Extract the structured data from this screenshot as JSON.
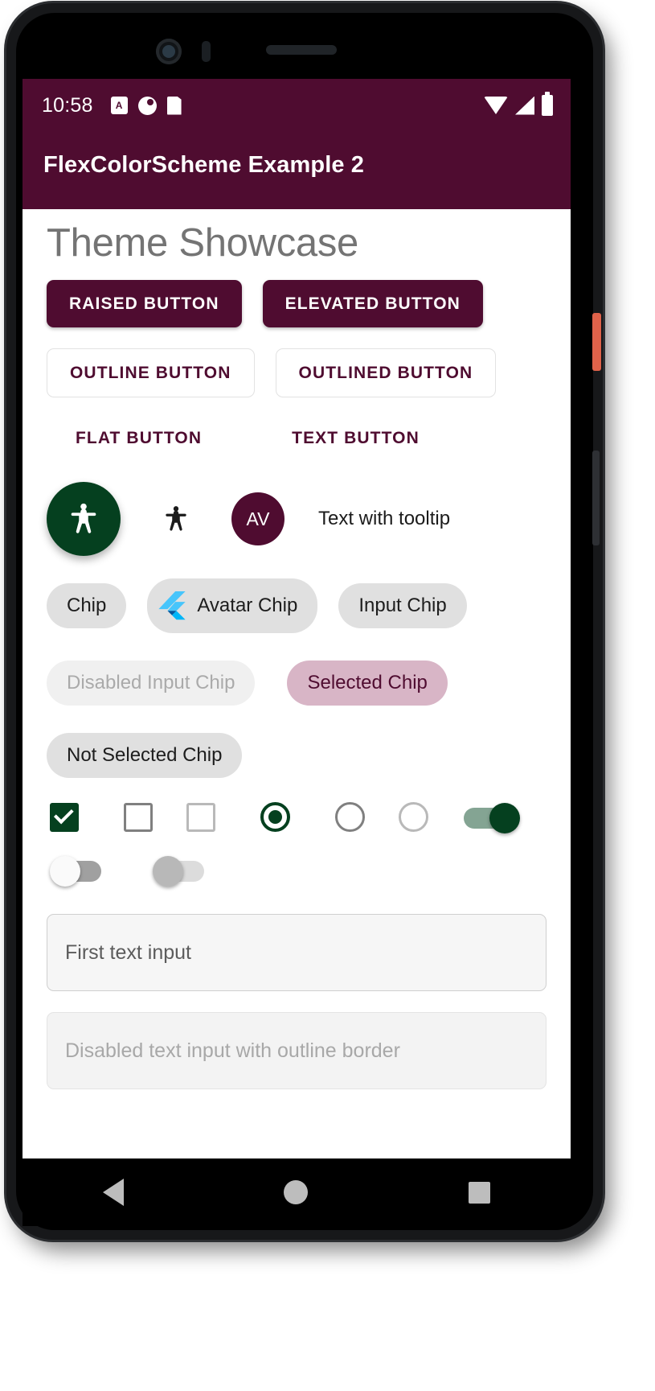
{
  "theme": {
    "brand_primary": "#4f0c30",
    "secondary": "#05401f",
    "chip_bg": "#e0e0e0",
    "chip_selected_bg": "#d8b5c6",
    "switch_on_track": "#84a493",
    "page_title_color": "#747474"
  },
  "status_bar": {
    "time": "10:58",
    "left_icons": [
      "a-badge-icon",
      "circle-contrast-icon",
      "sdcard-icon"
    ],
    "right_icons": [
      "wifi-icon",
      "cell-signal-icon",
      "battery-icon"
    ]
  },
  "app_bar": {
    "title": "FlexColorScheme Example 2"
  },
  "page": {
    "title": "Theme Showcase"
  },
  "buttons": {
    "raised": "RAISED BUTTON",
    "elevated": "ELEVATED BUTTON",
    "outline": "OUTLINE BUTTON",
    "outlined": "OUTLINED BUTTON",
    "flat": "FLAT BUTTON",
    "text": "TEXT BUTTON"
  },
  "icons_row": {
    "fab_icon": "accessibility-icon",
    "icon_button_icon": "accessibility-icon",
    "avatar_initials": "AV",
    "tooltip_label": "Text with tooltip"
  },
  "chips": {
    "plain": "Chip",
    "avatar": "Avatar Chip",
    "avatar_icon": "flutter-logo-icon",
    "input": "Input Chip",
    "disabled_input": "Disabled Input Chip",
    "selected": "Selected Chip",
    "not_selected": "Not Selected Chip"
  },
  "toggles": {
    "checkbox_checked": "checked",
    "checkbox_unchecked": "unchecked",
    "checkbox_disabled": "disabled",
    "radio_selected": "selected",
    "radio_unselected": "unselected",
    "radio_disabled": "disabled",
    "switch_on": "on",
    "switch_off": "off",
    "switch_disabled": "disabled"
  },
  "text_fields": {
    "first_value": "First text input",
    "first_placeholder": "First text input",
    "disabled_value": "Disabled text input with outline border",
    "disabled_placeholder": "Disabled text input with outline border"
  },
  "nav_bar": {
    "back": "back-icon",
    "home": "home-icon",
    "recents": "recents-icon"
  }
}
